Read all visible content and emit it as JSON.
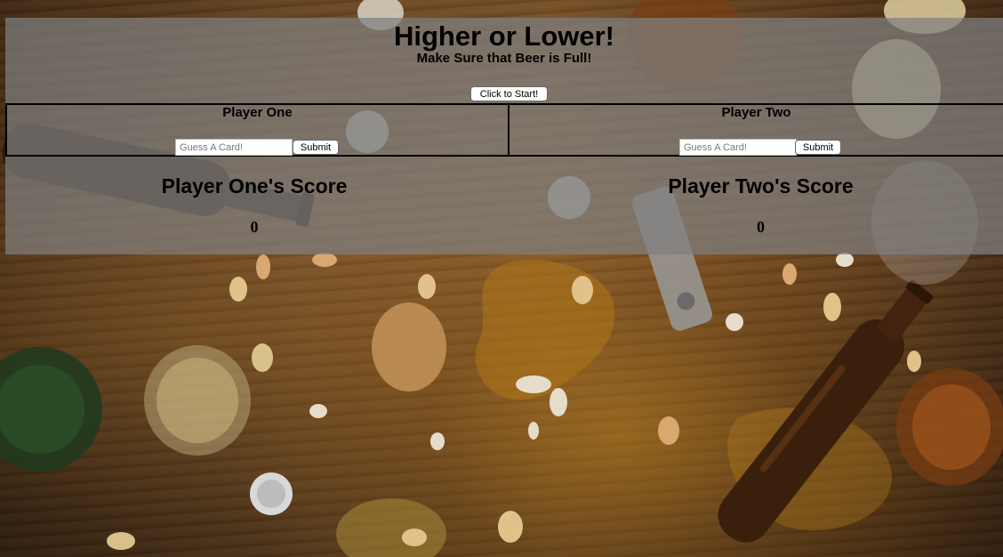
{
  "header": {
    "title": "Higher or Lower!",
    "subtitle": "Make Sure that Beer is Full!",
    "start_button": "Click to Start!"
  },
  "players": [
    {
      "label": "Player One",
      "guess_placeholder": "Guess A Card!",
      "submit_label": "Submit"
    },
    {
      "label": "Player Two",
      "guess_placeholder": "Guess A Card!",
      "submit_label": "Submit"
    }
  ],
  "scores": [
    {
      "title": "Player One's Score",
      "value": "0"
    },
    {
      "title": "Player Two's Score",
      "value": "0"
    }
  ],
  "colors": {
    "panel_overlay": "#808080",
    "text": "#000000",
    "table_wood": "#7a5228",
    "beer": "#b5801e",
    "bottle": "#3a1e0c"
  }
}
